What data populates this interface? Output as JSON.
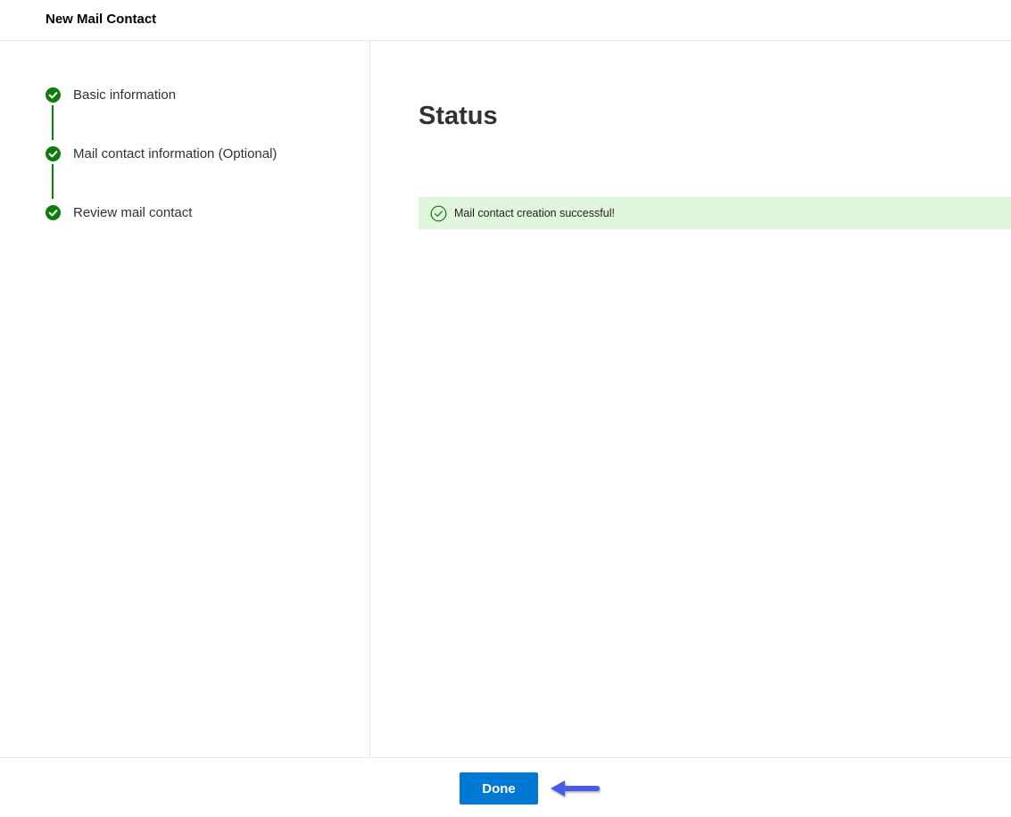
{
  "header": {
    "title": "New Mail Contact"
  },
  "steps": [
    {
      "label": "Basic information",
      "status": "completed",
      "icon": "check-circle-icon"
    },
    {
      "label": "Mail contact information (Optional)",
      "status": "completed",
      "icon": "check-circle-icon"
    },
    {
      "label": "Review mail contact",
      "status": "completed",
      "icon": "check-circle-icon"
    }
  ],
  "main": {
    "title": "Status",
    "message": {
      "text": "Mail contact creation successful!",
      "icon": "check-circle-outline-icon"
    }
  },
  "footer": {
    "done_label": "Done",
    "annotation_icon": "arrow-left-icon"
  },
  "colors": {
    "accent": "#0078d4",
    "success": "#107c10",
    "success_background": "#dff6dd",
    "annotation_arrow": "#4a5ce8"
  }
}
